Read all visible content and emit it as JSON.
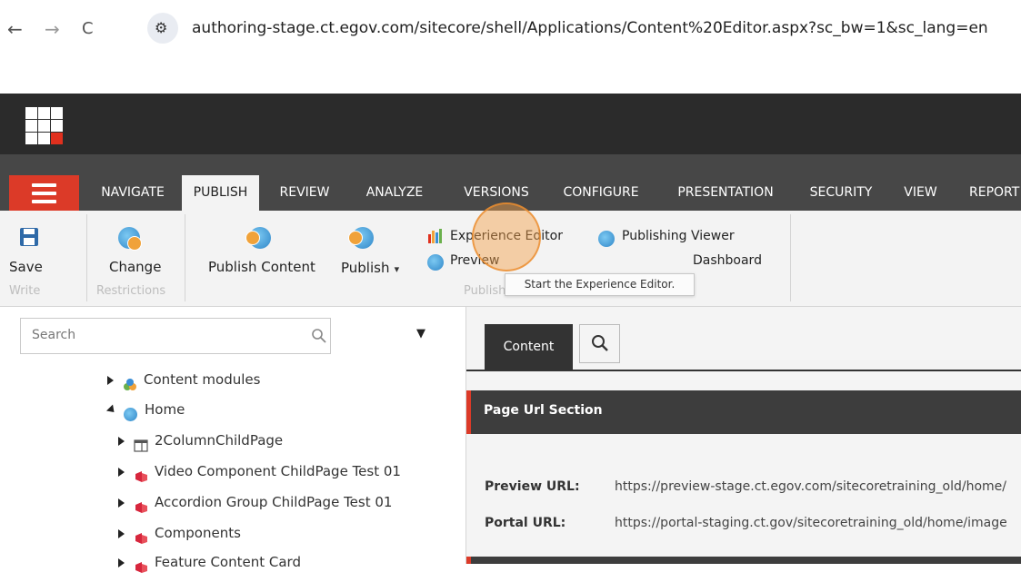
{
  "browser": {
    "back_glyph": "←",
    "forward_glyph": "→",
    "reload_glyph": "C",
    "site_info_glyph": "⚙",
    "url": "authoring-stage.ct.egov.com/sitecore/shell/Applications/Content%20Editor.aspx?sc_bw=1&sc_lang=en"
  },
  "ribbon_tabs": [
    {
      "label": "NAVIGATE"
    },
    {
      "label": "PUBLISH",
      "active": true
    },
    {
      "label": "REVIEW"
    },
    {
      "label": "ANALYZE"
    },
    {
      "label": "VERSIONS"
    },
    {
      "label": "CONFIGURE"
    },
    {
      "label": "PRESENTATION"
    },
    {
      "label": "SECURITY"
    },
    {
      "label": "VIEW"
    },
    {
      "label": "REPORT"
    }
  ],
  "ribbon": {
    "save_label": "Save",
    "write_group": "Write",
    "change_label": "Change",
    "restrictions_group": "Restrictions",
    "publish_content_label": "Publish Content",
    "publish_label": "Publish",
    "publish_caret": "▾",
    "experience_editor_label": "Experience Editor",
    "preview_label": "Preview",
    "publishing_viewer_label": "Publishing Viewer",
    "dashboard_label": "Dashboard",
    "publish_group": "Publish",
    "tooltip": "Start the Experience Editor."
  },
  "search": {
    "placeholder": "Search",
    "dropdown_glyph": "▼"
  },
  "tree": {
    "items": [
      {
        "label": "Content modules",
        "icon": "content-modules-icon",
        "expanded": false
      },
      {
        "label": "Home",
        "icon": "globe-icon",
        "expanded": true
      },
      {
        "label": "2ColumnChildPage",
        "icon": "page-icon",
        "expanded": false
      },
      {
        "label": "Video Component ChildPage Test 01",
        "icon": "component-icon",
        "expanded": false
      },
      {
        "label": "Accordion Group ChildPage Test 01",
        "icon": "component-icon",
        "expanded": false
      },
      {
        "label": "Components",
        "icon": "component-icon",
        "expanded": false
      },
      {
        "label": "Feature Content Card",
        "icon": "component-icon",
        "expanded": false
      }
    ]
  },
  "editor": {
    "content_tab": "Content",
    "section_title": "Page Url Section",
    "preview_url_label": "Preview URL:",
    "preview_url_value": "https://preview-stage.ct.egov.com/sitecoretraining_old/home/",
    "portal_url_label": "Portal URL:",
    "portal_url_value": "https://portal-staging.ct.gov/sitecoretraining_old/home/image"
  },
  "colors": {
    "accent_red": "#dc3a28",
    "topbar": "#2b2b2b",
    "tabbar": "#474747",
    "ribbon_bg": "#f3f3f3",
    "click_highlight": "#f5a046"
  }
}
